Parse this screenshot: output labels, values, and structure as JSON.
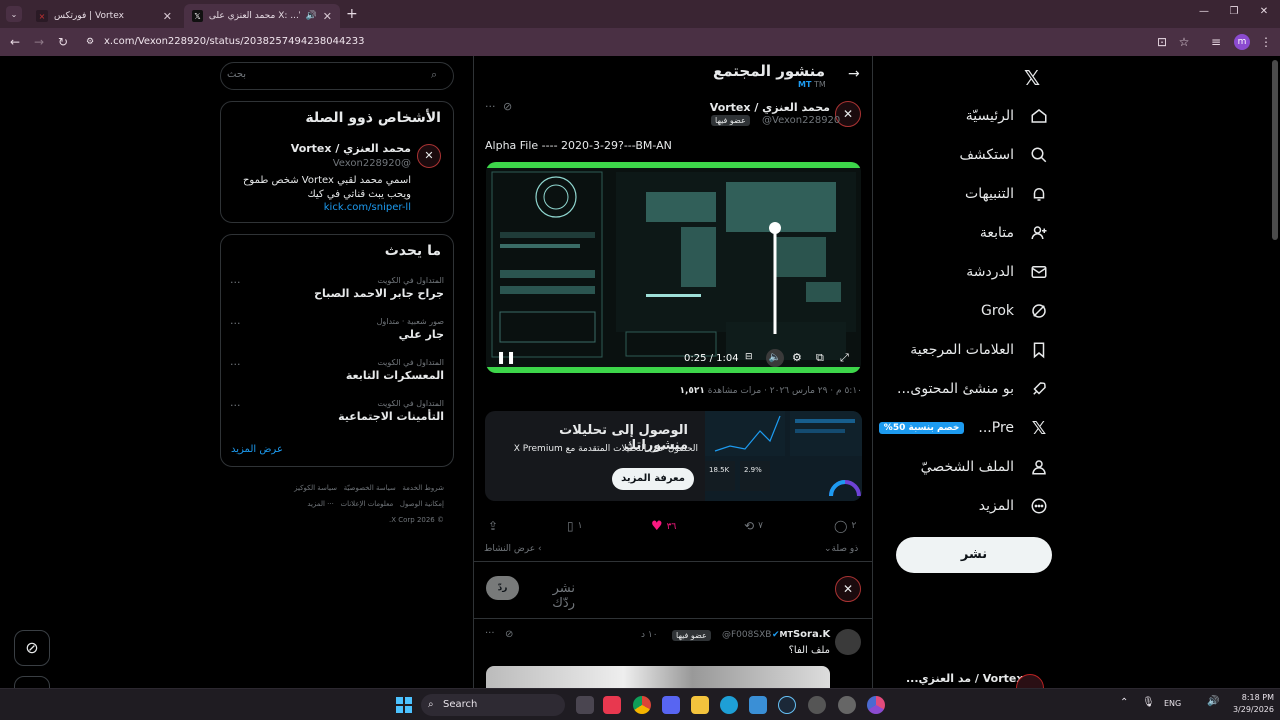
{
  "browser": {
    "tabs": [
      {
        "label": "فورتكس | Vortex",
        "active": false
      },
      {
        "label": "محمد العنزي على X: ...Vortex /",
        "active": true
      }
    ],
    "url": "x.com/Vexon228920/status/2038257494238044233",
    "profile_initial": "m"
  },
  "nav": {
    "home": "الرئيسيّة",
    "explore": "استكشف",
    "notifications": "التنبيهات",
    "follow": "متابعة",
    "chat": "الدردشة",
    "grok": "Grok",
    "bookmarks": "العلامات المرجعية",
    "creators": "...بو منشئ المحتوى",
    "premium": "...Pre",
    "premium_badge": "%خصم بنسبة 50",
    "profile": "الملف الشخصيّ",
    "more": "المزيد",
    "post_button": "نشر",
    "account_name": "...مد العنزي / Vortex"
  },
  "header": {
    "title": "منشور المجتمع",
    "subtitle": "MT"
  },
  "post": {
    "author_name": "محمد العنزي / Vortex",
    "handle": "@Vexon228920",
    "member_badge": "عضو فيها",
    "text": "Alpha File ---- 2020-3-29?---BM-AN",
    "video_time": "0:25 / 1:04",
    "meta_time": "٥:١٠ م · ٢٩ مارس ٢٠٢٦ ·",
    "views_label": "مرات مشاهدة",
    "views_count": "١,٥٢١",
    "like_count": "٣٦",
    "repost_count": "٧",
    "reply_count": "٢",
    "bookmark_count": "١",
    "related_label": "ذو صلة",
    "activity_label": "عرض النشاط",
    "reply_placeholder": "نشر ردّك",
    "reply_button": "ردّ"
  },
  "promo": {
    "title": "الوصول إلى تحليلات منشوراتك",
    "subtitle": "الحصول على التحليلات المتقدمة مع X Premium",
    "button": "معرفة المزيد",
    "stat1": "18.5K",
    "stat2": "2.9%"
  },
  "reply": {
    "author_name": "Sora.K",
    "author_prefix": "MT",
    "handle": "@F008SXB",
    "member_badge": "عضو فيها",
    "time": "١٠ د",
    "text": "ملف الفا؟"
  },
  "sidebar": {
    "search_placeholder": "بحث",
    "related_title": "الأشخاص ذوو الصلة",
    "related_person": {
      "name": "محمد العنزي / Vortex",
      "handle": "@Vexon228920",
      "bio": "اسمي محمد لقبي Vortex شخص طموح ويحب يبث قناتي في كيك",
      "link": "kick.com/sniper-ll"
    },
    "trending_title": "ما يحدث",
    "trends": [
      {
        "category": "المتداول في الكويت",
        "name": "جراح جابر الاحمد الصباح"
      },
      {
        "category": "صور شعبية · متداول",
        "name": "جار علي"
      },
      {
        "category": "المتداول في الكويت",
        "name": "المعسكرات التابعة"
      },
      {
        "category": "المتداول في الكويت",
        "name": "التأمينات الاجتماعية"
      }
    ],
    "show_more": "عرض المزيد",
    "footer_links": [
      "شروط الخدمة",
      "سياسة الخصوصيّة",
      "سياسة الكوكيز",
      "إمكانية الوصول",
      "معلومات الإعلانات",
      "··· المزيد"
    ],
    "copyright": "© 2026 X Corp."
  },
  "taskbar": {
    "search": "Search",
    "lang": "ENG",
    "time": "8:18 PM",
    "date": "3/29/2026"
  },
  "colors": {
    "like": "#f91880",
    "premium_badge": "#1d9bf0",
    "video_accent": "#3dd64a"
  }
}
